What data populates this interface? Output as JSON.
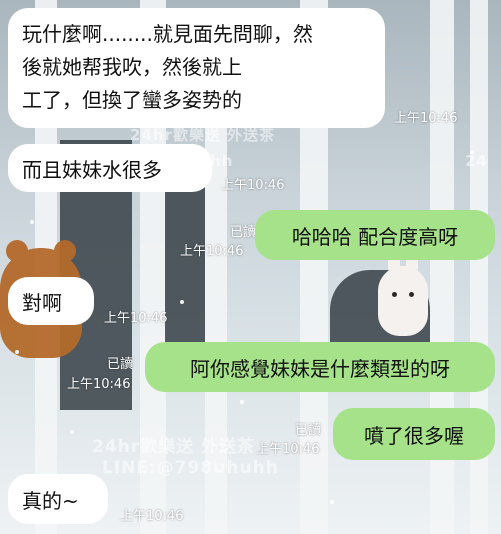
{
  "chat": {
    "messages": [
      {
        "side": "in",
        "text_lines": [
          "玩什麼啊........就見面先問聊，然",
          "後就她帮我吹，然後就上",
          "工了，但換了蠻多姿势的"
        ],
        "time": "上午10:46"
      },
      {
        "side": "in",
        "text": "而且妹妹水很多",
        "time": "上午10:46"
      },
      {
        "side": "out",
        "text": "哈哈哈 配合度高呀",
        "time": "上午10:46",
        "read": "已讀"
      },
      {
        "side": "in",
        "text": "對啊",
        "time": "上午10:46"
      },
      {
        "side": "out",
        "text": "阿你感覺妹妹是什麼類型的呀",
        "time": "上午10:46",
        "read": "已讀"
      },
      {
        "side": "out",
        "text": "噴了很多喔",
        "time": "上午10:46",
        "read": "已讀"
      },
      {
        "side": "in",
        "text": "真的~",
        "time": "上午10:46"
      }
    ]
  },
  "watermark": {
    "line1": "24hr歡樂送 外送茶",
    "line2": "LINE:@798uhuhh",
    "partial_top": "24hr歡樂送 外送茶",
    "partial_mid": "uhuhh",
    "partial_right": "24"
  },
  "colors": {
    "incoming_bubble": "#ffffff",
    "outgoing_bubble": "#a6e28a"
  }
}
